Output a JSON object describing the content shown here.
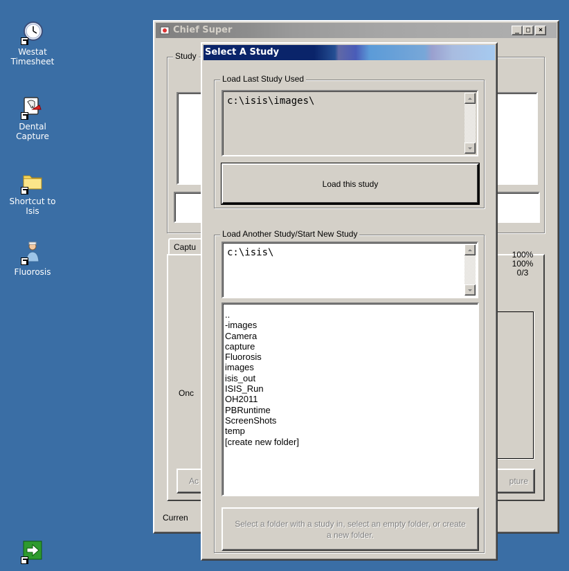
{
  "desktop": {
    "icons": [
      {
        "label": "Westat Timesheet",
        "icon": "clock-icon"
      },
      {
        "label": "Dental Capture",
        "icon": "tooth-icon"
      },
      {
        "label": "Shortcut to Isis",
        "icon": "folder-icon"
      },
      {
        "label": "Fluorosis",
        "icon": "doctor-icon"
      },
      {
        "label": "",
        "icon": "exit-arrow-icon"
      }
    ]
  },
  "main_window": {
    "title": "Chief Super",
    "study_group_label": "Study",
    "capture_tab_label": "Captu",
    "side_text": "Onc",
    "stats": [
      "100%",
      "100%",
      "0/3"
    ],
    "action_button_partial": "Ac",
    "capture_button_partial": "pture",
    "status_label": "Curren",
    "caption_buttons": [
      "_",
      "□",
      "×"
    ]
  },
  "dialog": {
    "title": "Select A Study",
    "last_study": {
      "group_label": "Load Last Study Used",
      "path": "c:\\isis\\images\\",
      "load_button": "Load this study"
    },
    "another_study": {
      "group_label": "Load Another Study/Start New Study",
      "path": "c:\\isis\\",
      "folders": [
        "..",
        "-images",
        "Camera",
        "capture",
        "Fluorosis",
        "images",
        "isis_out",
        "ISIS_Run",
        "OH2011",
        "PBRuntime",
        "ScreenShots",
        "temp",
        "[create new folder]"
      ],
      "hint_button": "Select a folder with a study in, select an empty folder, or create a new folder."
    }
  },
  "colors": {
    "desktop": "#3a6ea5",
    "face": "#d4d0c8",
    "dialog_title": "#0a246a"
  }
}
